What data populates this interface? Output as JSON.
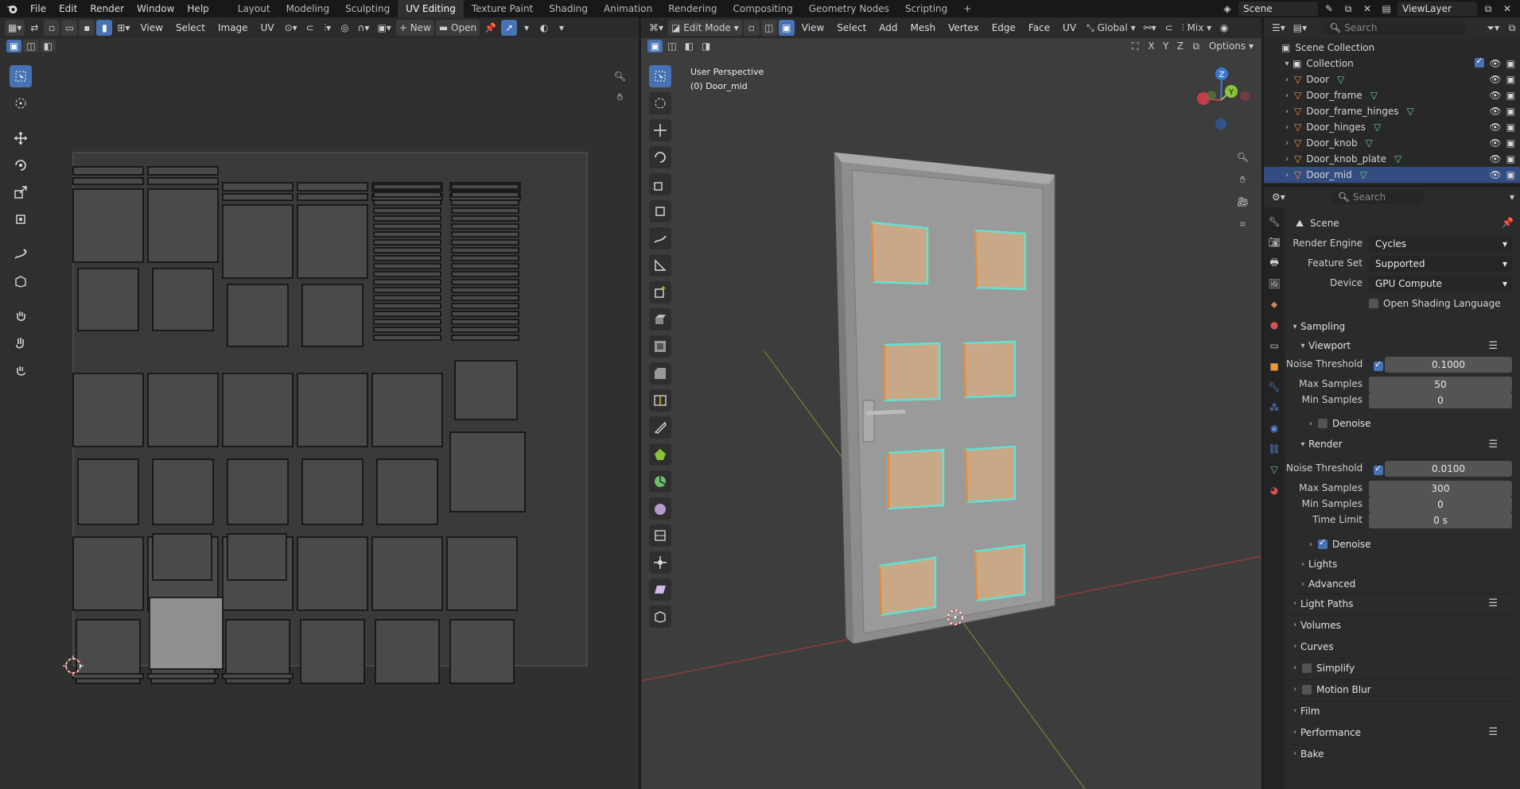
{
  "topbar": {
    "menus": [
      "File",
      "Edit",
      "Render",
      "Window",
      "Help"
    ],
    "workspaces": [
      "Layout",
      "Modeling",
      "Sculpting",
      "UV Editing",
      "Texture Paint",
      "Shading",
      "Animation",
      "Rendering",
      "Compositing",
      "Geometry Nodes",
      "Scripting"
    ],
    "active_workspace": "UV Editing",
    "add_tab": "+",
    "scene": "Scene",
    "view_layer": "ViewLayer"
  },
  "uv_editor": {
    "menus": [
      "View",
      "Select",
      "Image",
      "UV"
    ],
    "new_label": "New",
    "open_label": "Open"
  },
  "viewport": {
    "mode": "Edit Mode",
    "menus": [
      "View",
      "Select",
      "Add",
      "Mesh",
      "Vertex",
      "Edge",
      "Face",
      "UV"
    ],
    "orientation": "Global",
    "shading_mix": "Mix",
    "options_label": "Options",
    "axes": [
      "X",
      "Y",
      "Z"
    ],
    "perspective": "User Perspective",
    "object": "(0) Door_mid",
    "gizmo": {
      "z": "Z",
      "y": "Y"
    }
  },
  "outliner": {
    "search_placeholder": "Search",
    "scene_collection": "Scene Collection",
    "collection": "Collection",
    "objects": [
      "Door",
      "Door_frame",
      "Door_frame_hinges",
      "Door_hinges",
      "Door_knob",
      "Door_knob_plate",
      "Door_mid"
    ],
    "selected": "Door_mid"
  },
  "properties": {
    "search_placeholder": "Search",
    "context": "Scene",
    "render_engine_label": "Render Engine",
    "render_engine": "Cycles",
    "feature_set_label": "Feature Set",
    "feature_set": "Supported",
    "device_label": "Device",
    "device": "GPU Compute",
    "osl_label": "Open Shading Language",
    "sampling": "Sampling",
    "viewport": "Viewport",
    "vp_noise_label": "Noise Threshold",
    "vp_noise": "0.1000",
    "vp_max_label": "Max Samples",
    "vp_max": "50",
    "vp_min_label": "Min Samples",
    "vp_min": "0",
    "denoise": "Denoise",
    "render": "Render",
    "r_noise_label": "Noise Threshold",
    "r_noise": "0.0100",
    "r_max_label": "Max Samples",
    "r_max": "300",
    "r_min_label": "Min Samples",
    "r_min": "0",
    "time_limit_label": "Time Limit",
    "time_limit": "0 s",
    "lights": "Lights",
    "advanced": "Advanced",
    "panels": [
      "Light Paths",
      "Volumes",
      "Curves",
      "Simplify",
      "Motion Blur",
      "Film",
      "Performance",
      "Bake"
    ]
  },
  "colors": {
    "accent": "#4772b3",
    "selection": "#334d80",
    "door_panel": "#c9a888",
    "edge_cyan": "#5fe3d2",
    "edge_orange": "#e8893a"
  }
}
